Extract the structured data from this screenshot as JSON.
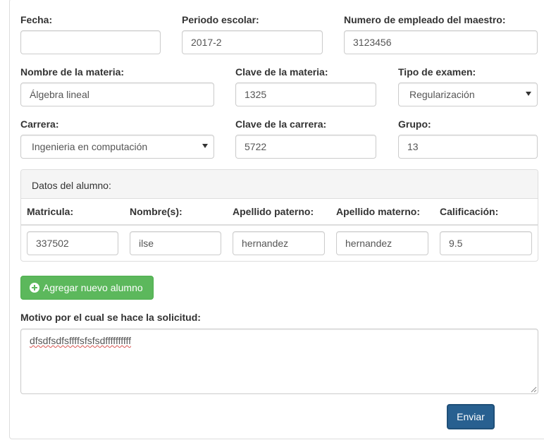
{
  "fields": {
    "fecha": {
      "label": "Fecha:",
      "value": ""
    },
    "periodo": {
      "label": "Periodo escolar:",
      "value": "2017-2"
    },
    "num_empleado": {
      "label": "Numero de empleado del maestro:",
      "value": "3123456"
    },
    "materia": {
      "label": "Nombre de la materia:",
      "value": "Álgebra lineal"
    },
    "clave_materia": {
      "label": "Clave de la materia:",
      "value": "1325"
    },
    "tipo_examen": {
      "label": "Tipo de examen:",
      "value": "Regularización"
    },
    "carrera": {
      "label": "Carrera:",
      "value": "Ingenieria en computación"
    },
    "clave_carrera": {
      "label": "Clave de la carrera:",
      "value": "5722"
    },
    "grupo": {
      "label": "Grupo:",
      "value": "13"
    }
  },
  "alumnos": {
    "panel_title": "Datos del alumno:",
    "columns": [
      "Matricula:",
      "Nombre(s):",
      "Apellido paterno:",
      "Apellido materno:",
      "Calificación:"
    ],
    "rows": [
      [
        "337502",
        "ilse",
        "hernandez",
        "hernandez",
        "9.5"
      ]
    ]
  },
  "add_student_label": "Agregar nuevo alumno",
  "motivo": {
    "label": "Motivo por el cual se hace la solicitud:",
    "value": "dfsdfsdfsffffsfsfsdffffffffff"
  },
  "submit_label": "Enviar",
  "colors": {
    "success": "#5cb85c",
    "primary": "#286090",
    "panel_heading": "#f5f5f5",
    "border": "#dddddd"
  },
  "icons": {
    "add": "plus-circle-icon",
    "select": "caret-down-icon",
    "resize": "resize-grip-icon"
  }
}
